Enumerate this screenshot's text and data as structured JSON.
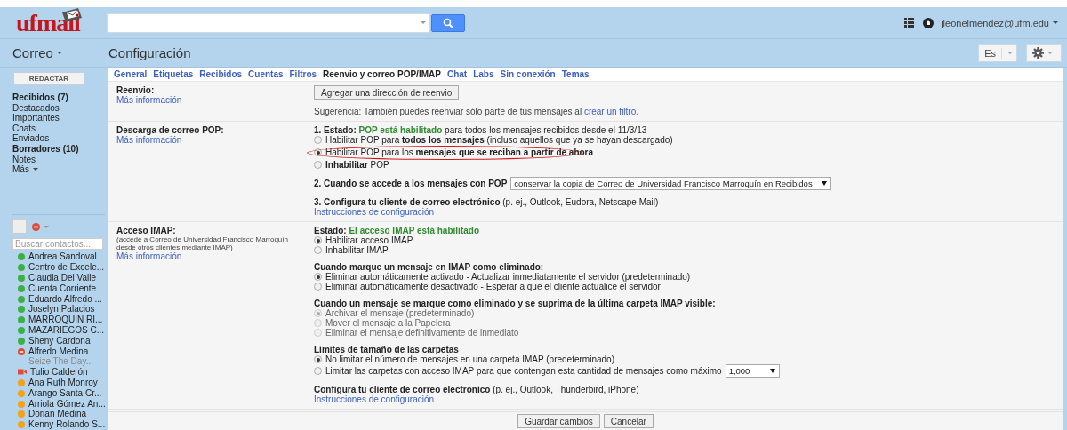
{
  "logo": {
    "text": "ufmail"
  },
  "header": {
    "account": "jleonelmendez@ufm.edu"
  },
  "subheader": {
    "app_menu": "Correo",
    "title": "Configuración",
    "language": "Es"
  },
  "sidebar": {
    "compose": "REDACTAR",
    "items": [
      {
        "label": "Recibidos (7)",
        "bold": true
      },
      {
        "label": "Destacados",
        "bold": false
      },
      {
        "label": "Importantes",
        "bold": false
      },
      {
        "label": "Chats",
        "bold": false
      },
      {
        "label": "Enviados",
        "bold": false
      },
      {
        "label": "Borradores (10)",
        "bold": true
      },
      {
        "label": "Notes",
        "bold": false
      },
      {
        "label": "Más",
        "bold": false,
        "kind": "more"
      }
    ],
    "contact_search": {
      "placeholder": "Buscar contactos..."
    },
    "contacts": [
      {
        "name": "Andrea Sandoval",
        "kind": "dot",
        "color": "#3cb043"
      },
      {
        "name": "Centro de Excele...",
        "kind": "dot",
        "color": "#3cb043"
      },
      {
        "name": "Claudia Del Valle",
        "kind": "dot",
        "color": "#3cb043"
      },
      {
        "name": "Cuenta Corriente",
        "kind": "dot",
        "color": "#3cb043"
      },
      {
        "name": "Eduardo Alfredo ...",
        "kind": "dot",
        "color": "#3cb043"
      },
      {
        "name": "Joselyn Palacios",
        "kind": "dot",
        "color": "#3cb043"
      },
      {
        "name": "MARROQUIN RI...",
        "kind": "dot",
        "color": "#3cb043"
      },
      {
        "name": "MAZARIEGOS C...",
        "kind": "dot",
        "color": "#3cb043"
      },
      {
        "name": "Sheny Cardona",
        "kind": "dot",
        "color": "#3cb043"
      },
      {
        "name": "Alfredo Medina",
        "kind": "busy",
        "color": "#dd4b39",
        "status": "Seize The Day..."
      },
      {
        "name": "Tulio Calderón",
        "kind": "video",
        "color": "#dd4b39"
      },
      {
        "name": "Ana Ruth Monroy",
        "kind": "dot",
        "color": "#f4a21c"
      },
      {
        "name": "Arango Santa Cr...",
        "kind": "dot",
        "color": "#f4a21c"
      },
      {
        "name": "Arriola Gómez An...",
        "kind": "dot",
        "color": "#f4a21c"
      },
      {
        "name": "Dorian Medina",
        "kind": "dot",
        "color": "#f4a21c"
      },
      {
        "name": "Kenny Rolando S...",
        "kind": "dot",
        "color": "#f4a21c"
      }
    ]
  },
  "tabs": [
    {
      "label": "General",
      "selected": false
    },
    {
      "label": "Etiquetas",
      "selected": false
    },
    {
      "label": "Recibidos",
      "selected": false
    },
    {
      "label": "Cuentas",
      "selected": false
    },
    {
      "label": "Filtros",
      "selected": false
    },
    {
      "label": "Reenvio y correo POP/IMAP",
      "selected": true
    },
    {
      "label": "Chat",
      "selected": false
    },
    {
      "label": "Labs",
      "selected": false
    },
    {
      "label": "Sin conexión",
      "selected": false
    },
    {
      "label": "Temas",
      "selected": false
    }
  ],
  "sections": [
    {
      "title": "Reenvio:",
      "link": "Más información",
      "blocks": [
        {
          "kind": "button",
          "label": "Agregar una dirección de reenvio"
        },
        {
          "kind": "note",
          "text": "Sugerencia: También puedes reenviar sólo parte de tus mensajes al",
          "link": "crear un filtro."
        }
      ]
    },
    {
      "title": "Descarga de correo POP:",
      "link": "Más información",
      "blocks": [
        {
          "kind": "radios",
          "status": {
            "label": "1. Estado:",
            "value": "POP está habilitado",
            "rest": "para todos los mensajes recibidos desde el 11/3/13"
          },
          "options": [
            {
              "label": "Habilitar POP para **todos los mensajes** (incluso aquellos que ya se hayan descargado)",
              "selected": false,
              "disabled": false,
              "circled": false
            },
            {
              "label": "Habilitar POP para los **mensajes que se reciban a partir de ahora**",
              "selected": true,
              "disabled": false,
              "circled": true
            },
            {
              "label": "**Inhabilitar** POP",
              "selected": false,
              "disabled": false,
              "circled": false
            }
          ]
        },
        {
          "kind": "select",
          "text": "**2. Cuando se accede a los mensajes con POP**",
          "value": "conservar la copia de Correo de Universidad Francisco Marroquín en Recibidos"
        },
        {
          "kind": "config",
          "text": "**3. Configura tu cliente de correo electrónico** (p. ej., Outlook, Eudora, Netscape Mail)",
          "link": "Instrucciones de configuración"
        }
      ]
    },
    {
      "title": "Acceso IMAP:",
      "note": "(accede a Correo de Universidad Francisco Marroquín desde otros clientes mediante IMAP)",
      "link": "Más información",
      "blocks": [
        {
          "kind": "radios",
          "status": {
            "label": "Estado:",
            "value": "El acceso IMAP está habilitado"
          },
          "options": [
            {
              "label": "Habilitar acceso IMAP",
              "selected": true,
              "disabled": false
            },
            {
              "label": "Inhabilitar IMAP",
              "selected": false,
              "disabled": false
            }
          ]
        },
        {
          "kind": "radios",
          "heading": "Cuando marque un mensaje en IMAP como eliminado:",
          "options": [
            {
              "label": "Eliminar automáticamente activado - Actualizar inmediatamente el servidor (predeterminado)",
              "selected": true,
              "disabled": false
            },
            {
              "label": "Eliminar automáticamente desactivado - Esperar a que el cliente actualice el servidor",
              "selected": false,
              "disabled": false
            }
          ]
        },
        {
          "kind": "radios",
          "heading": "Cuando un mensaje se marque como eliminado y se suprima de la última carpeta IMAP visible:",
          "options": [
            {
              "label": "Archivar el mensaje (predeterminado)",
              "selected": true,
              "disabled": true
            },
            {
              "label": "Mover el mensaje a la Papelera",
              "selected": false,
              "disabled": true
            },
            {
              "label": "Eliminar el mensaje definitivamente de inmediato",
              "selected": false,
              "disabled": true
            }
          ]
        },
        {
          "kind": "radios",
          "heading": "Límites de tamaño de las carpetas",
          "options": [
            {
              "label": "No limitar el número de mensajes en una carpeta IMAP (predeterminado)",
              "selected": true,
              "disabled": false
            },
            {
              "label": "Limitar las carpetas con acceso IMAP para que contengan esta cantidad de mensajes como máximo",
              "selected": false,
              "disabled": false,
              "select": "1,000"
            }
          ]
        },
        {
          "kind": "config",
          "text": "**Configura tu cliente de correo electrónico** (p. ej., Outlook, Thunderbird, iPhone)",
          "link": "Instrucciones de configuración"
        }
      ]
    }
  ],
  "footer": {
    "buttons": [
      "Guardar cambios",
      "Cancelar"
    ]
  }
}
